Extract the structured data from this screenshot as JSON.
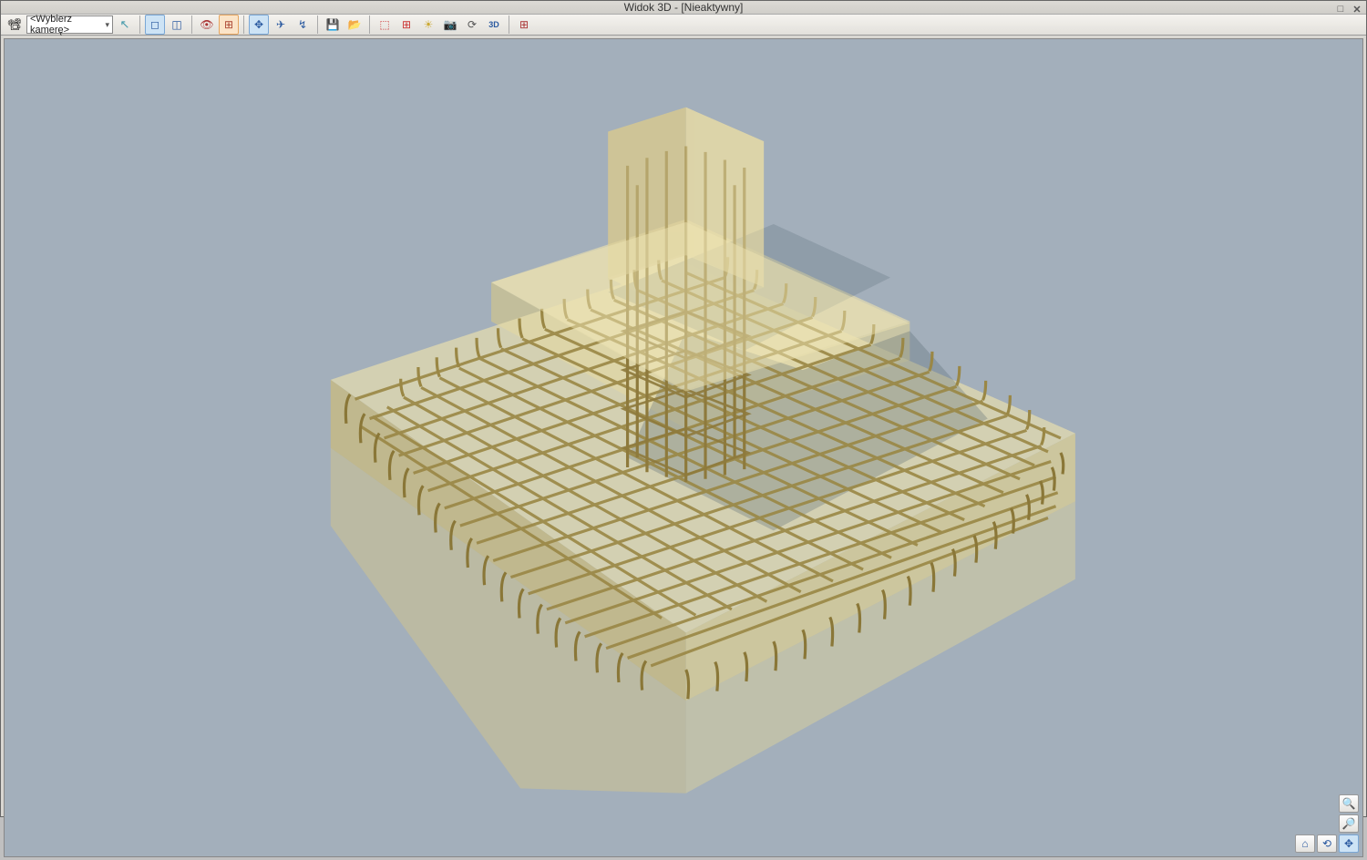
{
  "window": {
    "title": "Widok 3D - [Nieaktywny]"
  },
  "toolbar": {
    "camera_select": "<Wybierz kamerę>"
  },
  "icons": {
    "camera": "📷",
    "cursor": "↖",
    "move": "✥",
    "orbit": "⟳",
    "eye": "👁",
    "brick": "▦",
    "plane": "✈",
    "home": "⌂",
    "disk": "💾",
    "plus": "✚",
    "crosshair": "✛",
    "maximize": "□",
    "close": "✕",
    "chev": "▾",
    "zoom_in": "🔍",
    "rotate": "⟲",
    "hand": "✋",
    "cube": "⬚"
  }
}
